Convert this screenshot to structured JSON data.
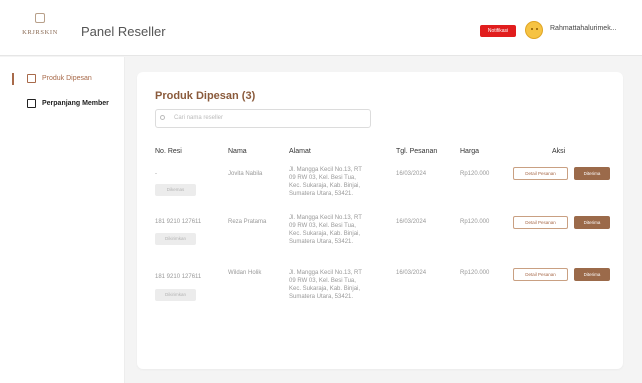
{
  "header": {
    "logo_text": "KRJRSKIN",
    "panel_title": "Panel Reseller",
    "status_badge": "Notifikasi",
    "username": "Rahmattahalurimek..."
  },
  "sidebar": {
    "items": [
      {
        "label": "Produk Dipesan",
        "active": true
      },
      {
        "label": "Perpanjang Member",
        "active": false
      }
    ]
  },
  "main": {
    "title": "Produk Dipesan (3)",
    "search_placeholder": "Cari nama reseller",
    "columns": [
      "No. Resi",
      "Nama",
      "Alamat",
      "Tgl. Pesanan",
      "Harga",
      "Aksi"
    ],
    "rows": [
      {
        "resi": "-",
        "status": "Dikemas",
        "nama": "Jovita Nabila",
        "alamat_1": "Jl. Mangga Kecil No.13, RT",
        "alamat_2": "09 RW 03, Kel. Besi Tua,",
        "alamat_3": "Kec. Sukaraja, Kab. Binjai,",
        "alamat_4": "Sumatera Utara, 53421.",
        "tgl": "16/03/2024",
        "harga": "Rp120.000",
        "detail_label": "Detail Pesanan",
        "action_label": "Diterima"
      },
      {
        "resi": "181 9210 127611",
        "status": "Dikirimkan",
        "nama": "Reza Pratama",
        "alamat_1": "Jl. Mangga Kecil No.13, RT",
        "alamat_2": "09 RW 03, Kel. Besi Tua,",
        "alamat_3": "Kec. Sukaraja, Kab. Binjai,",
        "alamat_4": "Sumatera Utara, 53421.",
        "tgl": "16/03/2024",
        "harga": "Rp120.000",
        "detail_label": "Detail Pesanan",
        "action_label": "Diterima"
      },
      {
        "resi": "181 9210 127611",
        "status": "Dikirimkan",
        "nama": "Wildan Holik",
        "alamat_1": "Jl. Mangga Kecil No.13, RT",
        "alamat_2": "09 RW 03, Kel. Besi Tua,",
        "alamat_3": "Kec. Sukaraja, Kab. Binjai,",
        "alamat_4": "Sumatera Utara, 53421.",
        "tgl": "16/03/2024",
        "harga": "Rp120.000",
        "detail_label": "Detail Pesanan",
        "action_label": "Diterima"
      }
    ]
  },
  "colors": {
    "accent": "#a86a4a",
    "accent_dark": "#9b6a4a",
    "badge_red": "#e11d1d"
  },
  "icons": [
    "box-icon",
    "card-icon",
    "search-icon",
    "avatar-emoji"
  ]
}
